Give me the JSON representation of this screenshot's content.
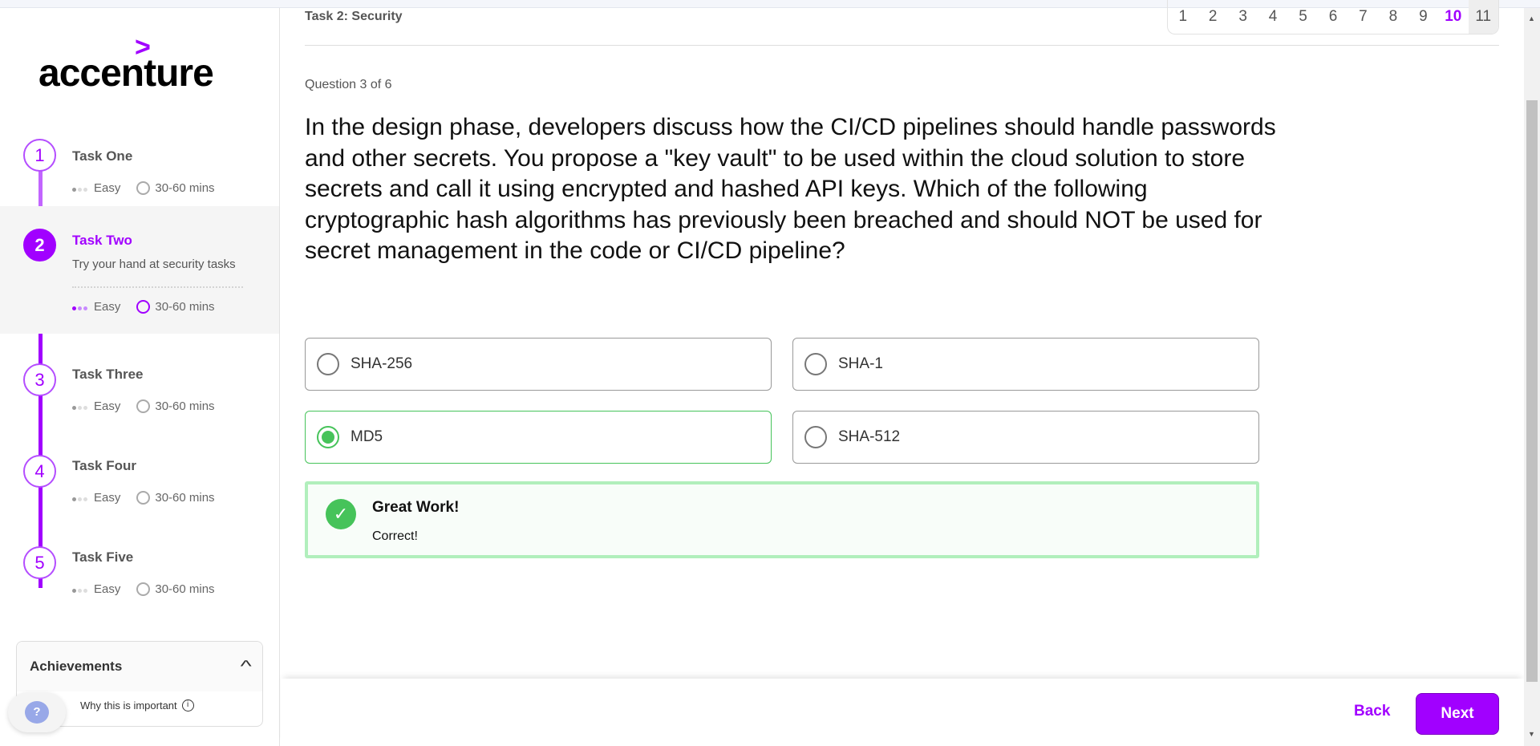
{
  "brand": {
    "logo_text": "accenture",
    "accent": "#a100ff"
  },
  "sidebar": {
    "steps": [
      {
        "num": "1",
        "title": "Task One",
        "difficulty": "Easy",
        "duration": "30-60 mins"
      },
      {
        "num": "2",
        "title": "Task Two",
        "description": "Try your hand at security tasks",
        "difficulty": "Easy",
        "duration": "30-60 mins",
        "active": true
      },
      {
        "num": "3",
        "title": "Task Three",
        "difficulty": "Easy",
        "duration": "30-60 mins"
      },
      {
        "num": "4",
        "title": "Task Four",
        "difficulty": "Easy",
        "duration": "30-60 mins"
      },
      {
        "num": "5",
        "title": "Task Five",
        "difficulty": "Easy",
        "duration": "30-60 mins"
      }
    ],
    "achievements": {
      "title": "Achievements",
      "why_label": "Why this is important"
    },
    "help_label": "?"
  },
  "header": {
    "task_label": "Task 2: Security",
    "pages": [
      "1",
      "2",
      "3",
      "4",
      "5",
      "6",
      "7",
      "8",
      "9",
      "10",
      "11"
    ],
    "current_page": "10"
  },
  "question": {
    "counter": "Question 3 of 6",
    "text": "In the design phase, developers discuss how the CI/CD pipelines should handle passwords and other secrets. You propose a \"key vault\" to be used within the cloud solution to store secrets and call it using encrypted and hashed API keys. Which of the following cryptographic hash algorithms has previously been breached and should NOT be used for secret management in the code or CI/CD pipeline?",
    "options": [
      "SHA-256",
      "SHA-1",
      "MD5",
      "SHA-512"
    ],
    "selected": "MD5"
  },
  "feedback": {
    "title": "Great Work!",
    "text": "Correct!",
    "color": "#46c35a"
  },
  "footer": {
    "back_label": "Back",
    "next_label": "Next"
  }
}
